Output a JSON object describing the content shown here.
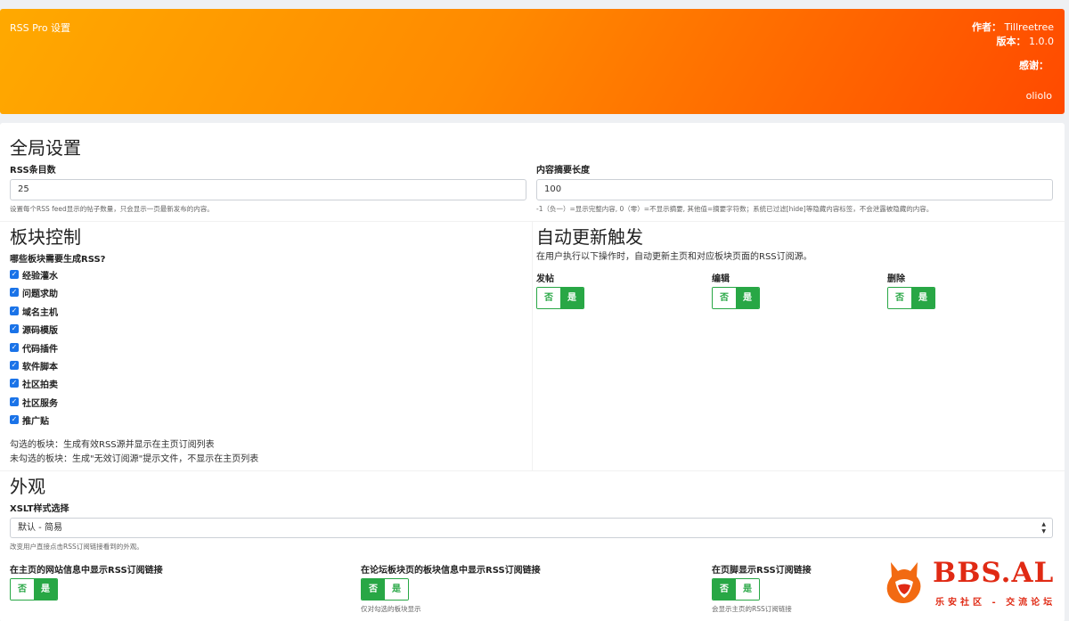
{
  "header": {
    "title": "RSS Pro 设置",
    "author_label": "作者：",
    "author": "Tillreetree",
    "version_label": "版本：",
    "version": "1.0.0",
    "thanks_label": "感谢：",
    "thanks_name": "oliolo"
  },
  "global": {
    "heading": "全局设置",
    "rss_count_label": "RSS条目数",
    "rss_count_value": "25",
    "rss_count_help": "设置每个RSS feed显示的帖子数量，只会显示一页最新发布的内容。",
    "summary_label": "内容摘要长度",
    "summary_value": "100",
    "summary_help": "-1（负一）=显示完整内容, 0（零）=不显示摘要, 其他值=摘要字符数；系统已过滤[hide]等隐藏内容标签，不会泄露被隐藏的内容。"
  },
  "forums": {
    "heading": "板块控制",
    "question": "哪些板块需要生成RSS?",
    "items": [
      {
        "label": "经验灌水"
      },
      {
        "label": "问题求助"
      },
      {
        "label": "域名主机"
      },
      {
        "label": "源码模版"
      },
      {
        "label": "代码插件"
      },
      {
        "label": "软件脚本"
      },
      {
        "label": "社区拍卖"
      },
      {
        "label": "社区服务"
      },
      {
        "label": "推广贴"
      }
    ],
    "note_checked": "勾选的板块：生成有效RSS源并显示在主页订阅列表",
    "note_unchecked": "未勾选的板块：生成\"无效订阅源\"提示文件，不显示在主页列表"
  },
  "auto": {
    "heading": "自动更新触发",
    "desc": "在用户执行以下操作时，自动更新主页和对应板块页面的RSS订阅源。",
    "post_label": "发帖",
    "edit_label": "编辑",
    "delete_label": "删除"
  },
  "toggle": {
    "no": "否",
    "yes": "是"
  },
  "appearance": {
    "heading": "外观",
    "xslt_label": "XSLT样式选择",
    "xslt_value": "默认 - 简易",
    "xslt_help": "改变用户直接点击RSS订阅链接看到的外观。",
    "home_label": "在主页的网站信息中显示RSS订阅链接",
    "forum_label": "在论坛板块页的板块信息中显示RSS订阅链接",
    "forum_help": "仅对勾选的板块显示",
    "footer_label": "在页脚显示RSS订阅链接",
    "footer_help": "会显示主页的RSS订阅链接"
  },
  "logo": {
    "brand": "BBS.AL",
    "slogan": "乐安社区 - 交流论坛"
  },
  "colors": {
    "accent": "#28a745",
    "header_start": "#ffa900",
    "header_end": "#ff4a00",
    "checkbox": "#1a73e8",
    "logo": "#e02a14"
  }
}
